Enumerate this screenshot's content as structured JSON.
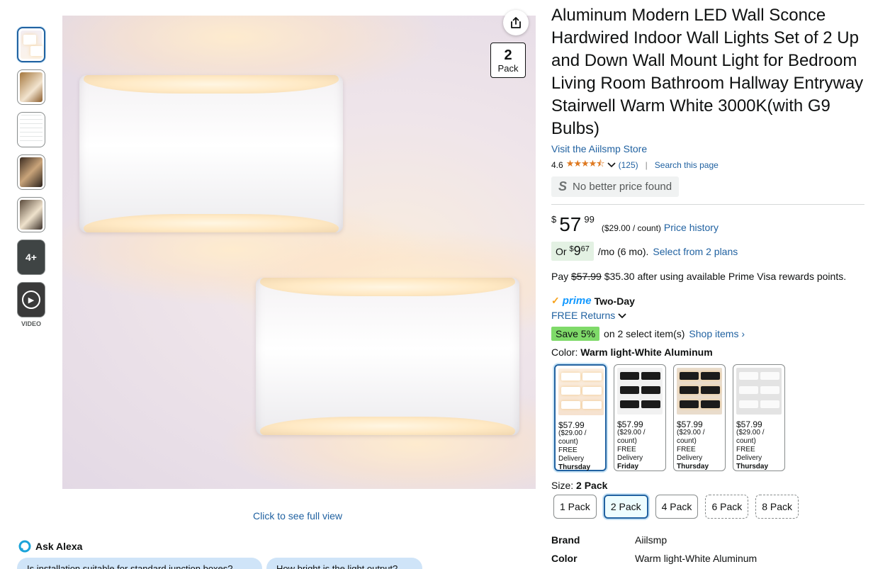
{
  "gallery": {
    "more_label": "4+",
    "video_label": "VIDEO",
    "pack_badge": {
      "number": "2",
      "label": "Pack"
    },
    "full_view_link": "Click to see full view"
  },
  "alexa": {
    "label": "Ask Alexa",
    "chips": [
      "Is installation suitable for standard junction boxes?",
      "How bright is the light output?"
    ]
  },
  "product": {
    "title": "Aluminum Modern LED Wall Sconce Hardwired Indoor Wall Lights Set of 2 Up and Down Wall Mount Light for Bedroom Living Room Bathroom Hallway Entryway Stairwell Warm White 3000K(with G9 Bulbs)",
    "store_link": "Visit the Aiilsmp Store",
    "rating": "4.6",
    "stars": "★★★★⯪",
    "review_count": "(125)",
    "search_page": "Search this page",
    "no_better_price": "No better price found",
    "no_better_price_icon": "S"
  },
  "price": {
    "currency": "$",
    "whole": "57",
    "fraction": "99",
    "per_count": "($29.00 / count)",
    "history_link": "Price history",
    "installment_or": "Or",
    "installment_amount": "9",
    "installment_cents": "67",
    "installment_term": "/mo (6 mo).",
    "installment_link": "Select from 2 plans",
    "pay_prefix": "Pay",
    "pay_strike": "$57.99",
    "pay_rest": "$35.30 after using available Prime Visa rewards points."
  },
  "delivery": {
    "prime_logo": "prime",
    "prime_speed": "Two-Day",
    "returns": "FREE Returns",
    "save_badge": "Save 5%",
    "save_text": "on 2 select item(s)",
    "shop_items": "Shop items ›"
  },
  "color": {
    "label": "Color:",
    "selected": "Warm light-White Aluminum",
    "options": [
      {
        "price": "$57.99",
        "per": "($29.00 / count)",
        "delivery": "FREE Delivery",
        "day": "Thursday"
      },
      {
        "price": "$57.99",
        "per": "($29.00 / count)",
        "delivery": "FREE Delivery",
        "day": "Friday"
      },
      {
        "price": "$57.99",
        "per": "($29.00 / count)",
        "delivery": "FREE Delivery",
        "day": "Thursday"
      },
      {
        "price": "$57.99",
        "per": "($29.00 / count)",
        "delivery": "FREE Delivery",
        "day": "Thursday"
      }
    ]
  },
  "size": {
    "label": "Size:",
    "selected": "2 Pack",
    "options": [
      "1 Pack",
      "2 Pack",
      "4 Pack",
      "6 Pack",
      "8 Pack"
    ]
  },
  "specs": [
    {
      "key": "Brand",
      "value": "Aiilsmp"
    },
    {
      "key": "Color",
      "value": "Warm light-White Aluminum"
    }
  ],
  "colors": {
    "link": "#2162a1",
    "selected_border": "#2162a1",
    "save_badge": "#7fda69",
    "star": "#de7921",
    "prime_blue": "#1399ff"
  }
}
